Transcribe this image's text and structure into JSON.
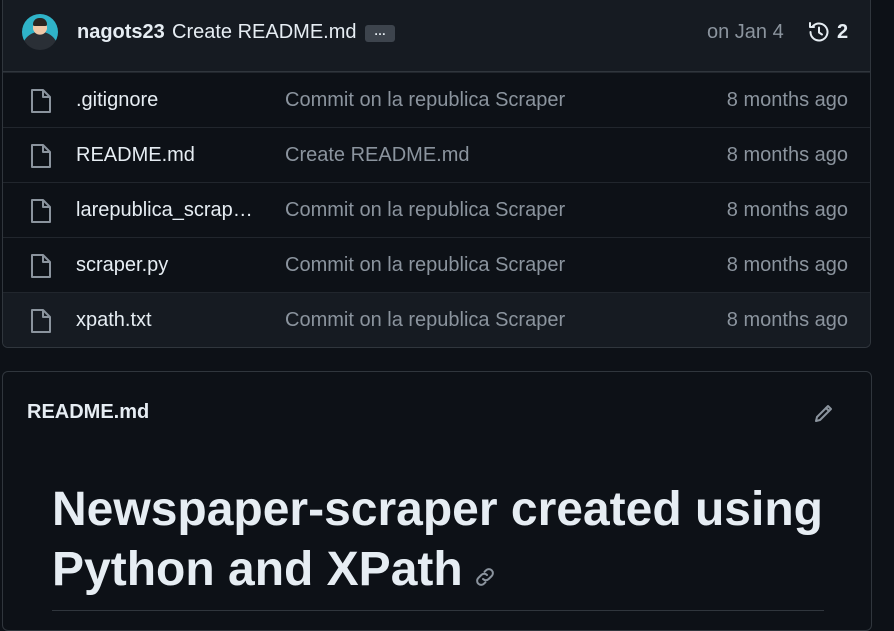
{
  "latest_commit": {
    "author": "nagots23",
    "message": "Create README.md",
    "ellipsis": "…",
    "date": "on Jan 4",
    "history_count": "2"
  },
  "files": [
    {
      "name": ".gitignore",
      "commit": "Commit on la republica Scraper",
      "age": "8 months ago"
    },
    {
      "name": "README.md",
      "commit": "Create README.md",
      "age": "8 months ago"
    },
    {
      "name": "larepublica_scrap…",
      "commit": "Commit on la republica Scraper",
      "age": "8 months ago"
    },
    {
      "name": "scraper.py",
      "commit": "Commit on la republica Scraper",
      "age": "8 months ago"
    },
    {
      "name": "xpath.txt",
      "commit": "Commit on la republica Scraper",
      "age": "8 months ago"
    }
  ],
  "readme": {
    "title": "README.md",
    "heading": "Newspaper-scraper created using Python and XPath"
  },
  "colors": {
    "background": "#0d1117",
    "header_bg": "#161b22",
    "border": "#30363d",
    "text": "#e6edf3",
    "muted": "#8b949e"
  },
  "icons": {
    "history": "history-icon",
    "file": "file-icon",
    "edit": "pencil-icon",
    "link": "link-icon"
  }
}
